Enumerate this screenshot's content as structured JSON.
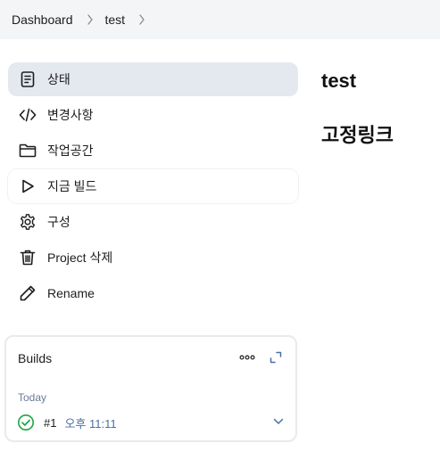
{
  "breadcrumb": {
    "items": [
      "Dashboard",
      "test"
    ]
  },
  "sidebar": {
    "items": [
      {
        "label": "상태",
        "icon": "document-icon"
      },
      {
        "label": "변경사항",
        "icon": "code-icon"
      },
      {
        "label": "작업공간",
        "icon": "folder-icon"
      },
      {
        "label": "지금 빌드",
        "icon": "play-icon"
      },
      {
        "label": "구성",
        "icon": "gear-icon"
      },
      {
        "label": "Project 삭제",
        "icon": "trash-icon"
      },
      {
        "label": "Rename",
        "icon": "pencil-icon"
      }
    ]
  },
  "builds": {
    "title": "Builds",
    "group_label": "Today",
    "entries": [
      {
        "number": "#1",
        "time": "오후 11:11",
        "status": "success"
      }
    ]
  },
  "main": {
    "title": "test",
    "subtitle": "고정링크"
  },
  "colors": {
    "active_bg": "#e4e8ef",
    "success": "#1ea446",
    "link": "#4a6fa5"
  }
}
